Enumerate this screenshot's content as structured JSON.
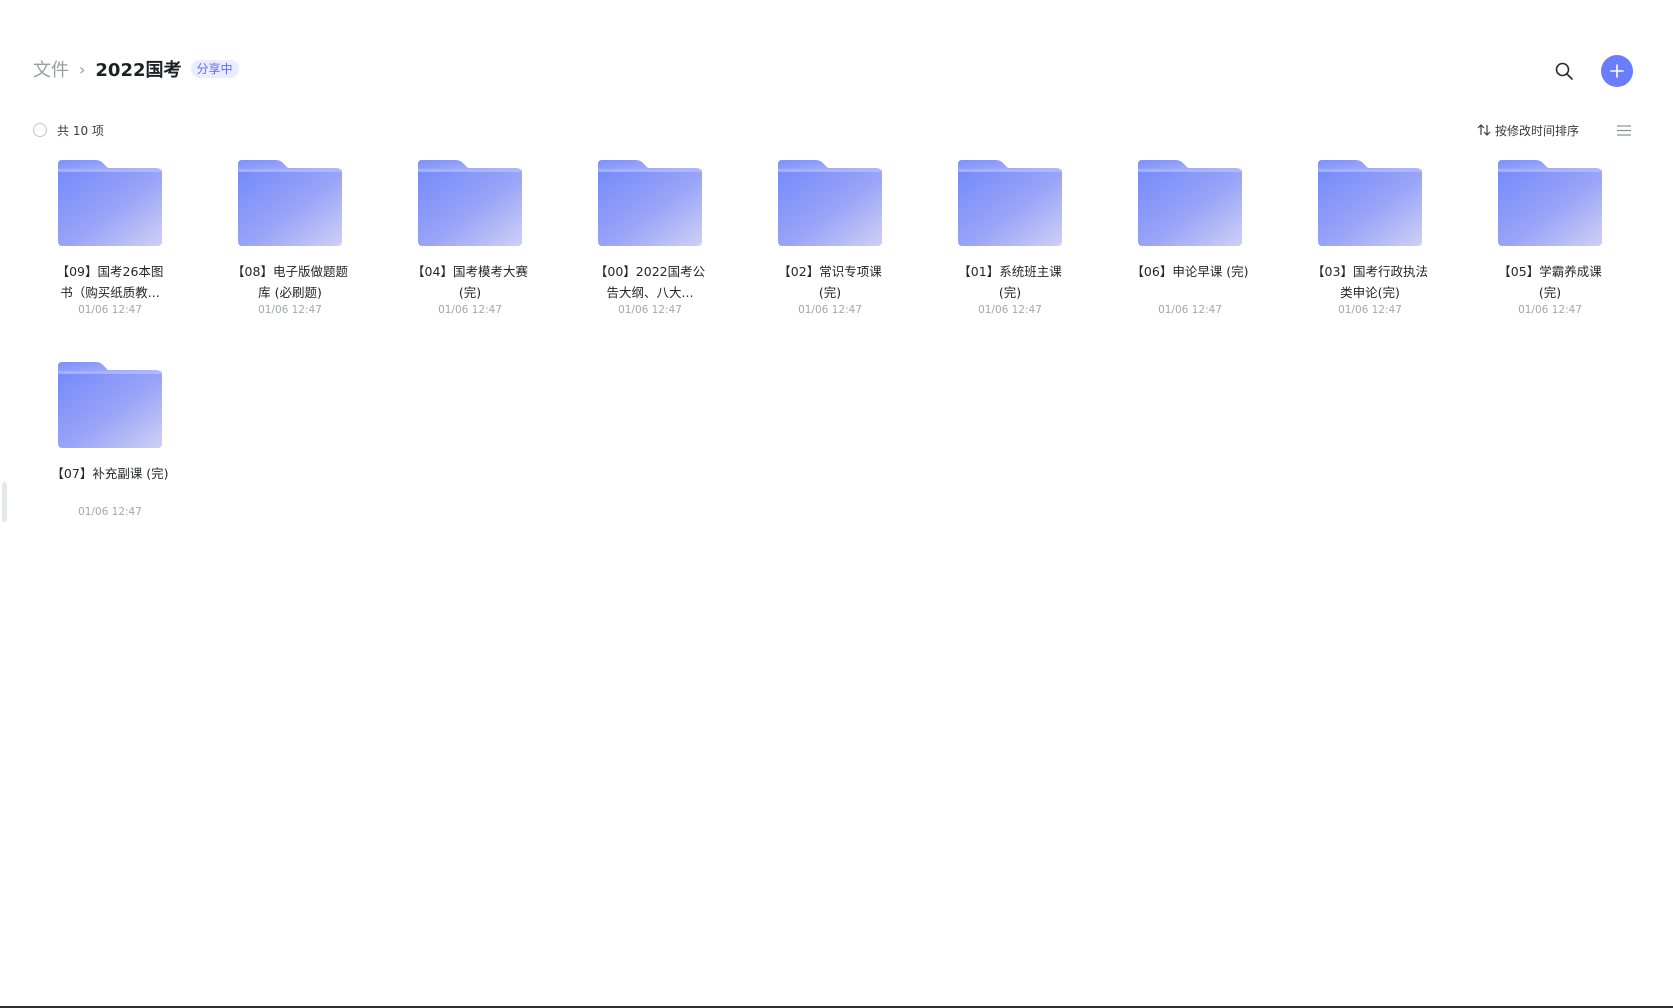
{
  "breadcrumb": {
    "root": "文件",
    "separator": "›",
    "current": "2022国考",
    "badge": "分享中"
  },
  "header": {
    "search_icon": "search-icon",
    "add_icon": "plus-icon",
    "accent_color": "#6b7dfc"
  },
  "toolbar": {
    "count_label": "共 10 项",
    "sort_label": "按修改时间排序",
    "sort_icon": "sort-arrows-icon",
    "view_icon": "list-view-icon"
  },
  "folders": [
    {
      "name": "【09】国考26本图书（购买纸质教...",
      "time": "01/06 12:47"
    },
    {
      "name": "【08】电子版做题题库 (必刷题)",
      "time": "01/06 12:47"
    },
    {
      "name": "【04】国考模考大赛 (完)",
      "time": "01/06 12:47"
    },
    {
      "name": "【00】2022国考公告大纲、八大...",
      "time": "01/06 12:47"
    },
    {
      "name": "【02】常识专项课 (完)",
      "time": "01/06 12:47"
    },
    {
      "name": "【01】系统班主课 (完)",
      "time": "01/06 12:47"
    },
    {
      "name": "【06】申论早课 (完)",
      "time": "01/06 12:47"
    },
    {
      "name": "【03】国考行政执法类申论(完)",
      "time": "01/06 12:47"
    },
    {
      "name": "【05】学霸养成课 (完)",
      "time": "01/06 12:47"
    },
    {
      "name": "【07】补充副课 (完)",
      "time": "01/06 12:47"
    }
  ]
}
